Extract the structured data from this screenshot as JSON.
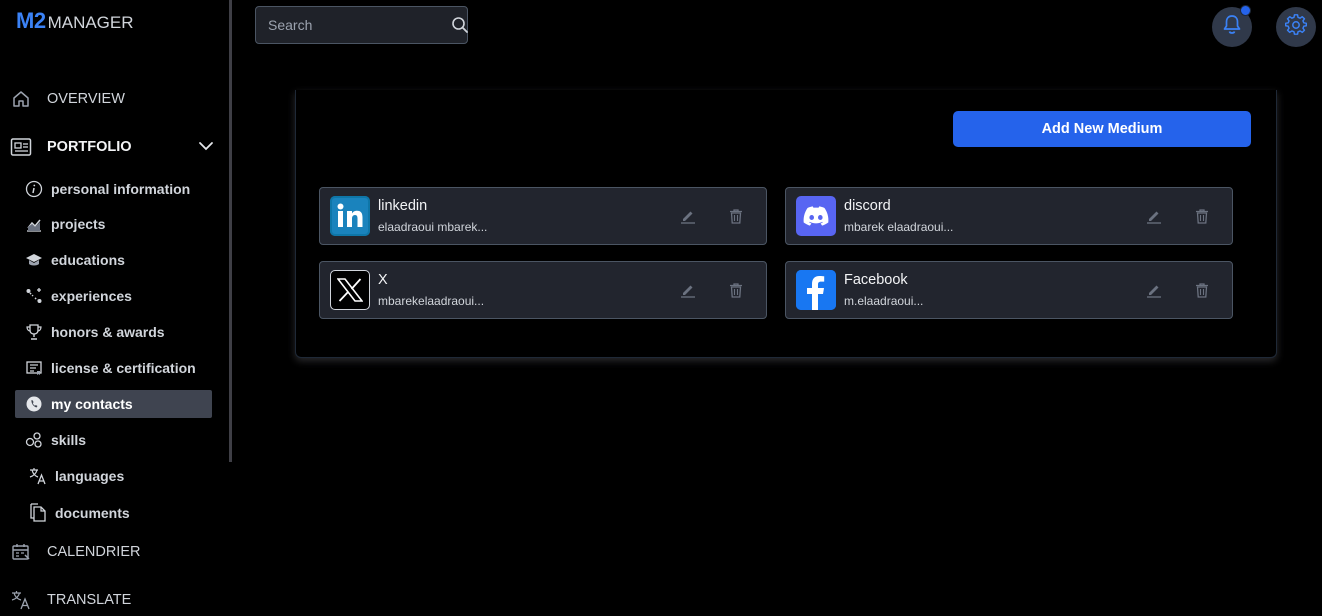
{
  "app": {
    "logo_m2": "M2",
    "logo_manager": "MANAGER"
  },
  "search": {
    "placeholder": "Search"
  },
  "nav": {
    "overview": "OVERVIEW",
    "portfolio": "PORTFOLIO",
    "calendrier": "CALENDRIER",
    "translate": "TRANSLATE"
  },
  "portfolio_items": [
    {
      "label": "personal information",
      "icon": "info-circle-icon"
    },
    {
      "label": "projects",
      "icon": "chart-icon"
    },
    {
      "label": "educations",
      "icon": "graduation-cap-icon"
    },
    {
      "label": "experiences",
      "icon": "path-icon"
    },
    {
      "label": "honors & awards",
      "icon": "trophy-icon"
    },
    {
      "label": "license & certification",
      "icon": "certificate-icon"
    },
    {
      "label": "my contacts",
      "icon": "contact-icon",
      "active": true
    },
    {
      "label": "skills",
      "icon": "skills-icon"
    },
    {
      "label": "languages",
      "icon": "translate-icon"
    },
    {
      "label": "documents",
      "icon": "documents-icon"
    }
  ],
  "actions": {
    "add_medium": "Add New Medium"
  },
  "contacts": [
    {
      "name": "linkedin",
      "handle": "elaadraoui mbarek...",
      "icon": "linkedin-icon"
    },
    {
      "name": "discord",
      "handle": "mbarek elaadraoui...",
      "icon": "discord-icon"
    },
    {
      "name": "X",
      "handle": "mbarekelaadraoui...",
      "icon": "x-icon"
    },
    {
      "name": "Facebook",
      "handle": "m.elaadraoui...",
      "icon": "facebook-icon"
    }
  ],
  "colors": {
    "accent": "#2563eb",
    "background": "#000000",
    "card": "#22252e",
    "active_item": "#3f4450"
  }
}
